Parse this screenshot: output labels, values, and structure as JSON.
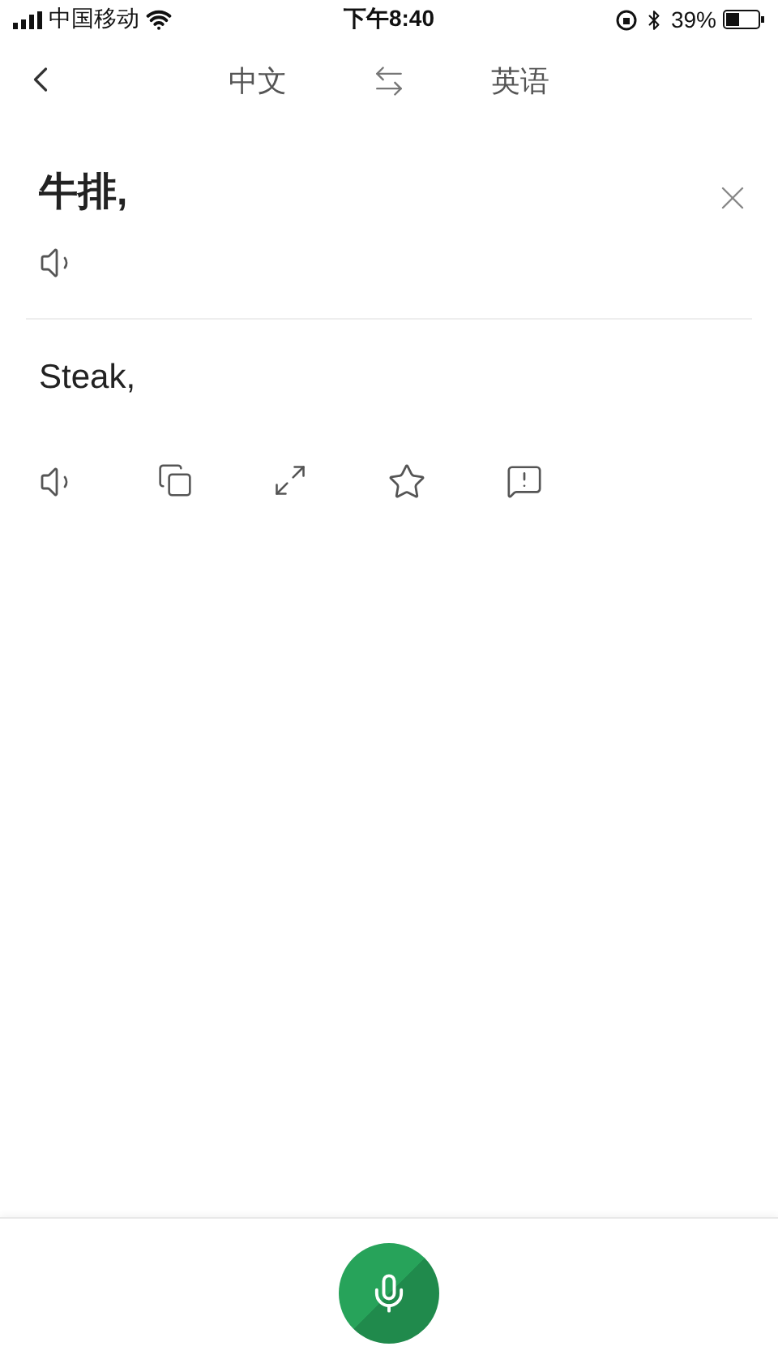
{
  "status_bar": {
    "carrier": "中国移动",
    "time": "下午8:40",
    "battery": "39%"
  },
  "nav": {
    "source_language": "中文",
    "target_language": "英语"
  },
  "source": {
    "text": "牛排,"
  },
  "result": {
    "text": "Steak,"
  }
}
